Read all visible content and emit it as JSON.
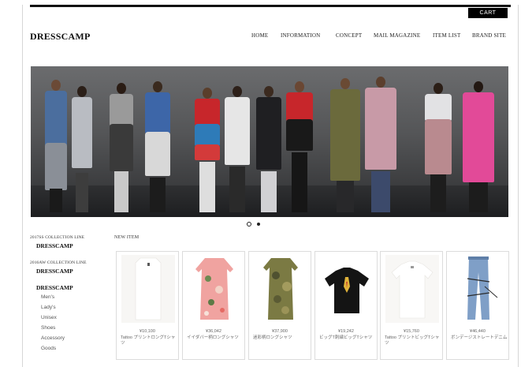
{
  "header": {
    "cart_label": "CART",
    "logo": "DRESSCAMP",
    "nav": [
      "HOME",
      "INFORMATION",
      "CONCEPT",
      "MAIL MAGAZINE",
      "ITEM LIST",
      "BRAND SITE"
    ]
  },
  "hero": {
    "slides_total": 2,
    "active_slide": 1
  },
  "sidebar": {
    "groups": [
      {
        "heading": "2017SS COLLECTION LINE",
        "brand": "DRESSCAMP"
      },
      {
        "heading": "2016AW COLLECTION LINE",
        "brand": "DRESSCAMP"
      }
    ],
    "category_brand": "DRESSCAMP",
    "categories": [
      "Men's",
      "Lady's",
      "Unisex",
      "Shoes",
      "Accessory",
      "Goods"
    ]
  },
  "new_items": {
    "label": "NEW ITEM",
    "items": [
      {
        "price": "¥10,100",
        "name": "Tattoo プリントロングTシャツ"
      },
      {
        "price": "¥36,042",
        "name": "イイダバー柄ロングシャツ"
      },
      {
        "price": "¥37,900",
        "name": "迷彩柄ロングシャツ"
      },
      {
        "price": "¥19,242",
        "name": "ビッグT刺繍ビッグTシャツ"
      },
      {
        "price": "¥15,760",
        "name": "Tattoo プリントビッグTシャツ"
      },
      {
        "price": "¥46,440",
        "name": "ボンデージストレートデニム"
      }
    ]
  },
  "colors": {
    "accent": "#000000",
    "dot_active": "#ffffff",
    "card_border": "#dcdcdc"
  }
}
